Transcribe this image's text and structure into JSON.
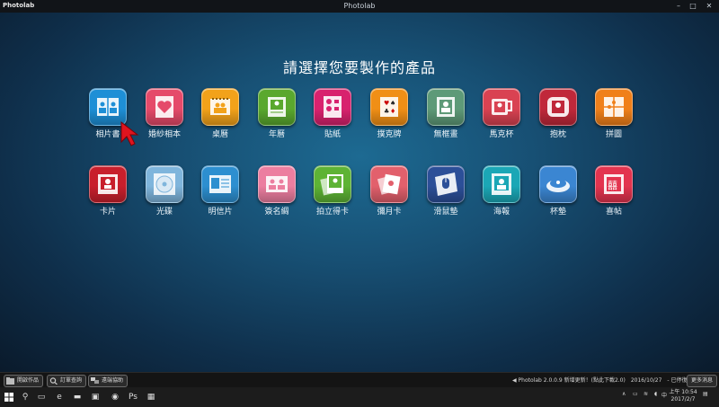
{
  "window": {
    "app_logo_text": "Photolab",
    "title": "Photolab",
    "minimize": "–",
    "maximize": "□",
    "close": "✕"
  },
  "heading": "請選擇您要製作的產品",
  "products": [
    {
      "label": "相片書",
      "color": "#1e8fd6",
      "icon": "book-icon"
    },
    {
      "label": "婚紗相本",
      "color": "#e54a6a",
      "icon": "heart-icon"
    },
    {
      "label": "桌曆",
      "color": "#f2a21a",
      "icon": "desk-calendar-icon"
    },
    {
      "label": "年曆",
      "color": "#5aa82e",
      "icon": "wall-calendar-icon"
    },
    {
      "label": "貼紙",
      "color": "#d8226e",
      "icon": "sticker-icon"
    },
    {
      "label": "撲克牌",
      "color": "#f08f16",
      "icon": "playing-cards-icon"
    },
    {
      "label": "無框畫",
      "color": "#5e9a78",
      "icon": "frameless-painting-icon"
    },
    {
      "label": "馬克杯",
      "color": "#d94252",
      "icon": "mug-icon"
    },
    {
      "label": "抱枕",
      "color": "#c0283a",
      "icon": "pillow-icon"
    },
    {
      "label": "拼圖",
      "color": "#f0801a",
      "icon": "puzzle-icon"
    },
    {
      "label": "卡片",
      "color": "#c81f2c",
      "icon": "card-icon"
    },
    {
      "label": "光碟",
      "color": "#7fb5dc",
      "icon": "cd-icon"
    },
    {
      "label": "明信片",
      "color": "#2d8fd0",
      "icon": "postcard-icon"
    },
    {
      "label": "簽名綢",
      "color": "#ec7ea0",
      "icon": "signature-silk-icon"
    },
    {
      "label": "拍立得卡",
      "color": "#5eb335",
      "icon": "instant-photo-icon"
    },
    {
      "label": "彌月卡",
      "color": "#e2606c",
      "icon": "baby-card-icon"
    },
    {
      "label": "滑鼠墊",
      "color": "#2c4f98",
      "icon": "mouse-pad-icon"
    },
    {
      "label": "海報",
      "color": "#1ba7b6",
      "icon": "poster-icon"
    },
    {
      "label": "杯墊",
      "color": "#3b86d2",
      "icon": "coaster-icon"
    },
    {
      "label": "喜帖",
      "color": "#e3344f",
      "icon": "wedding-invitation-icon"
    }
  ],
  "bottombar": {
    "open_works": "開啟作品",
    "order_query": "訂單查詢",
    "remote_support": "遠端協助",
    "news": "Photolab 2.0.0.9 新增更新！(點此下載2.0)　2016/10/27　- 已停復(...",
    "more_info": "更多消息"
  },
  "taskbar": {
    "time": "上午 10:54",
    "date": "2017/2/7",
    "lang": "中"
  }
}
